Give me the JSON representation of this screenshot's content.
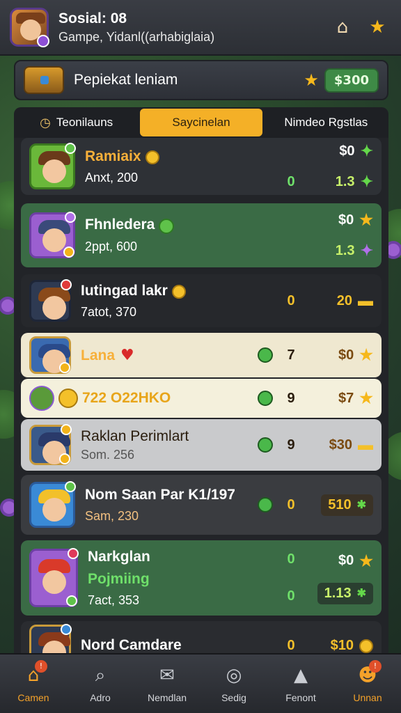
{
  "header": {
    "title": "Sosial: 08",
    "subtitle": "Gampe, Yidanl((arhabiglaia)",
    "icons": [
      "home-icon",
      "star-icon"
    ]
  },
  "panel": {
    "title": "Pepiekat leniam",
    "coins": "$300",
    "accent": "#f4b027"
  },
  "tabs": [
    {
      "label": "Teonilauns",
      "active": false
    },
    {
      "label": "Saycinelan",
      "active": true
    },
    {
      "label": "Nimdeo Rgstlas",
      "active": false
    }
  ],
  "rows": [
    {
      "name": "Ramiaix",
      "sub": "Anxt, 200",
      "stat": "0",
      "val1": "$0",
      "val2": "1.3"
    },
    {
      "name": "Fhnledera",
      "sub": "2ppt, 600",
      "val1": "$0",
      "val2": "1.3"
    },
    {
      "name": "Iutingad lakr",
      "sub": "7atot, 370",
      "stat": "0",
      "val1": "20"
    },
    {
      "name": "Lana",
      "stat": "7",
      "val1": "$0"
    },
    {
      "name": "722 O22HKO",
      "stat": "9",
      "val1": "$7"
    },
    {
      "name": "Raklan Perimlart",
      "sub": "Som. 256",
      "stat": "9",
      "val1": "$30"
    },
    {
      "name": "Nom Saan Par K1/197",
      "sub": "Sam, 230",
      "stat": "0",
      "val1": "510"
    },
    {
      "name": "Narkglan",
      "name2": "Pojmiing",
      "sub": "7act, 353",
      "stat": "0",
      "stat2": "0",
      "val1": "$0",
      "val2": "1.13"
    },
    {
      "name": "Nord Camdare",
      "stat": "0",
      "val1": "$10"
    }
  ],
  "nav": [
    {
      "label": "Camen",
      "icon": "home-icon",
      "active": true,
      "badge": "!"
    },
    {
      "label": "Adro",
      "icon": "search-icon",
      "active": false
    },
    {
      "label": "Nemdlan",
      "icon": "mail-icon",
      "active": false
    },
    {
      "label": "Sedig",
      "icon": "settings-icon",
      "active": false
    },
    {
      "label": "Fenont",
      "icon": "profile-icon",
      "active": false
    },
    {
      "label": "Unnan",
      "icon": "group-icon",
      "active": true,
      "badge": "!"
    }
  ]
}
